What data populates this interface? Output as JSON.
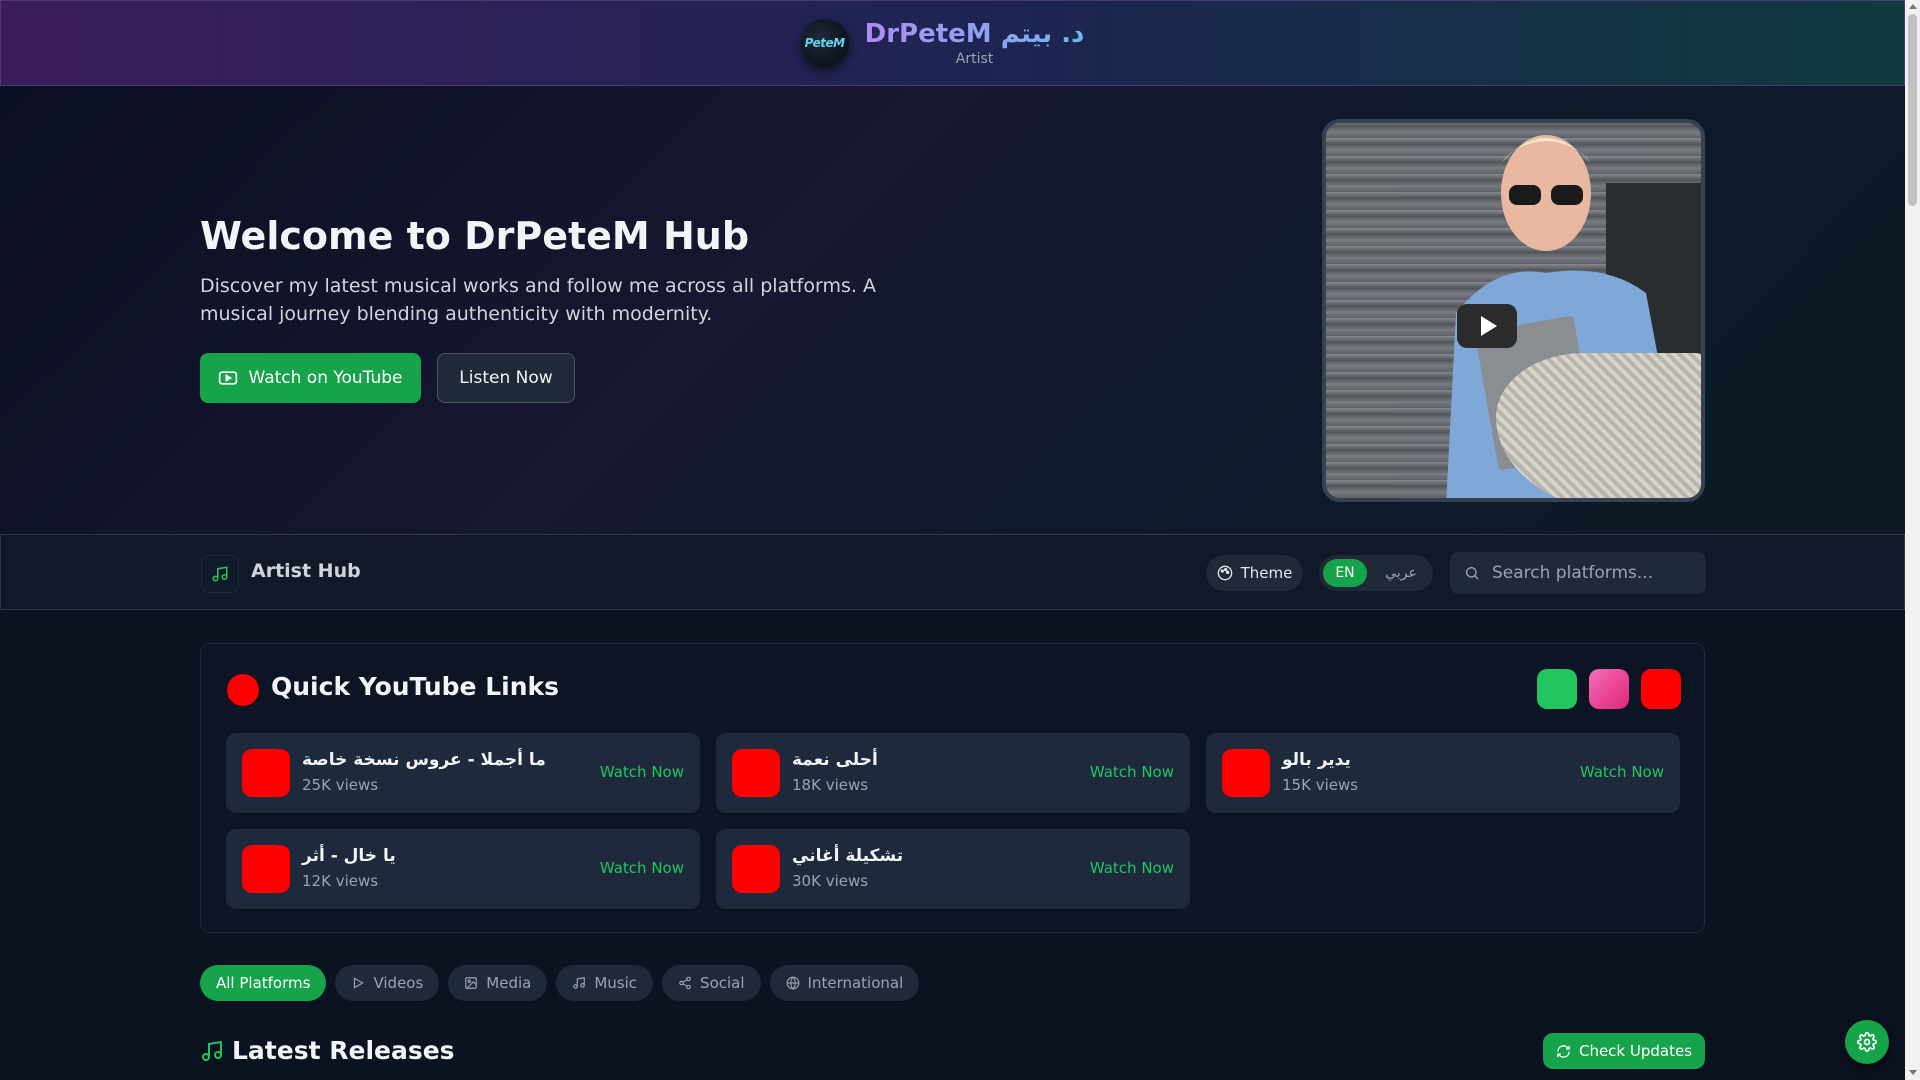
{
  "header": {
    "logo_text": "PeteM",
    "brand_name": "DrPeteM د. بيتم",
    "brand_subtitle": "Artist"
  },
  "hero": {
    "title": "Welcome to DrPeteM Hub",
    "description": "Discover my latest musical works and follow me across all platforms. A musical journey blending authenticity with modernity.",
    "watch_button": "Watch on YouTube",
    "listen_button": "Listen Now"
  },
  "hub": {
    "title": "Artist Hub",
    "theme_label": "Theme",
    "lang_en": "EN",
    "lang_ar": "عربي",
    "search_placeholder": "Search platforms..."
  },
  "quick_links": {
    "title": "Quick YouTube Links",
    "platform_colors": [
      "#22c55e",
      "#ec4899",
      "#ff0000"
    ],
    "items": [
      {
        "title": "ما أجملا - عروس نسخة خاصة",
        "views": "25K views",
        "action": "Watch Now"
      },
      {
        "title": "أحلى نعمة",
        "views": "18K views",
        "action": "Watch Now"
      },
      {
        "title": "يدير بالو",
        "views": "15K views",
        "action": "Watch Now"
      },
      {
        "title": "يا خال - أثر",
        "views": "12K views",
        "action": "Watch Now"
      },
      {
        "title": "تشكيلة أغاني",
        "views": "30K views",
        "action": "Watch Now"
      }
    ]
  },
  "filters": {
    "chips": [
      {
        "label": "All Platforms",
        "icon": "none",
        "active": true
      },
      {
        "label": "Videos",
        "icon": "play-icon",
        "active": false
      },
      {
        "label": "Media",
        "icon": "image-icon",
        "active": false
      },
      {
        "label": "Music",
        "icon": "music-note-icon",
        "active": false
      },
      {
        "label": "Social",
        "icon": "share-icon",
        "active": false
      },
      {
        "label": "International",
        "icon": "globe-icon",
        "active": false
      }
    ]
  },
  "releases": {
    "title": "Latest Releases",
    "check_button": "Check Updates"
  },
  "colors": {
    "accent": "#16a34a",
    "youtube_red": "#ff0000",
    "background": "#0b1220"
  }
}
